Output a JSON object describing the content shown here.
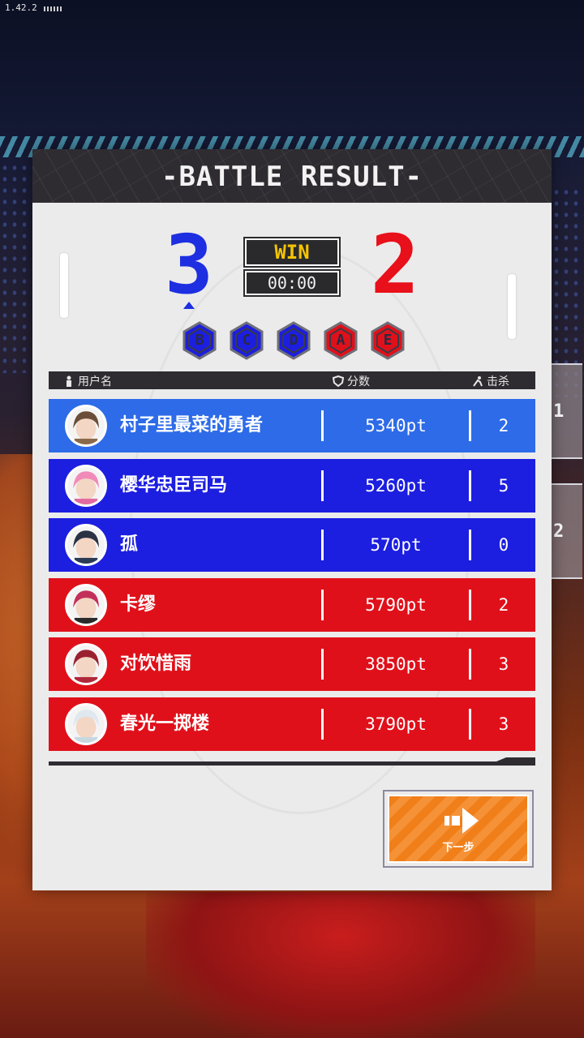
{
  "version": "1.42.2",
  "title": "-BATTLE RESULT-",
  "score": {
    "blue": "3",
    "red": "2",
    "result": "WIN",
    "time": "00:00"
  },
  "points": [
    {
      "letter": "B",
      "team": "blue"
    },
    {
      "letter": "C",
      "team": "blue"
    },
    {
      "letter": "D",
      "team": "blue"
    },
    {
      "letter": "A",
      "team": "red"
    },
    {
      "letter": "E",
      "team": "red"
    }
  ],
  "table": {
    "headers": {
      "name": "用户名",
      "score": "分数",
      "kills": "击杀"
    },
    "rows": [
      {
        "name": "村子里最菜的勇者",
        "score": "5340pt",
        "kills": "2",
        "team": "blue"
      },
      {
        "name": "樱华忠臣司马",
        "score": "5260pt",
        "kills": "5",
        "team": "blue"
      },
      {
        "name": "孤",
        "score": "570pt",
        "kills": "0",
        "team": "blue"
      },
      {
        "name": "卡缪",
        "score": "5790pt",
        "kills": "2",
        "team": "red"
      },
      {
        "name": "对饮惜雨",
        "score": "3850pt",
        "kills": "3",
        "team": "red"
      },
      {
        "name": "春光一掷楼",
        "score": "3790pt",
        "kills": "3",
        "team": "red"
      }
    ]
  },
  "side_tabs": [
    "1",
    "2"
  ],
  "next_button": {
    "label": "下一步"
  },
  "colors": {
    "blue": "#1c1ee0",
    "blue_highlight": "#2d6be8",
    "red": "#e0101a",
    "win_yellow": "#f5c400",
    "next_orange": "#f07f1a"
  }
}
